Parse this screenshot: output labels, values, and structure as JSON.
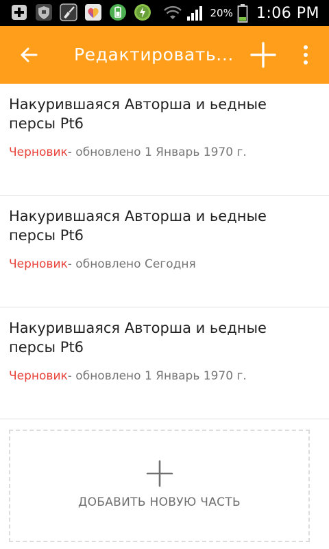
{
  "status_bar": {
    "battery_percent": "20%",
    "time": "1:06 PM"
  },
  "toolbar": {
    "title": "Редактировать..."
  },
  "parts": [
    {
      "title": "Накурившаяся Авторша и ьедные персы Pt6",
      "status": "Черновик",
      "updated": "- обновлено 1 Январь 1970 г."
    },
    {
      "title": "Накурившаяся Авторша и ьедные персы Pt6",
      "status": "Черновик",
      "updated": "- обновлено Сегодня"
    },
    {
      "title": "Накурившаяся Авторша и ьедные персы Pt6",
      "status": "Черновик",
      "updated": "- обновлено 1 Январь 1970 г."
    }
  ],
  "add_part": {
    "label": "ДОБАВИТЬ НОВУЮ ЧАСТЬ"
  },
  "colors": {
    "accent": "#FF9E1B",
    "draft": "#E8423A",
    "status_bar": "#000000"
  },
  "icons": {
    "status_bar": [
      "add-notification-icon",
      "shield-icon",
      "broom-icon",
      "heart-app-icon",
      "battery-app-icon",
      "power-app-icon",
      "wifi-icon",
      "signal-icon",
      "battery-icon"
    ],
    "toolbar": [
      "back-arrow-icon",
      "add-icon",
      "more-vert-icon"
    ],
    "add_part": "plus-icon"
  }
}
